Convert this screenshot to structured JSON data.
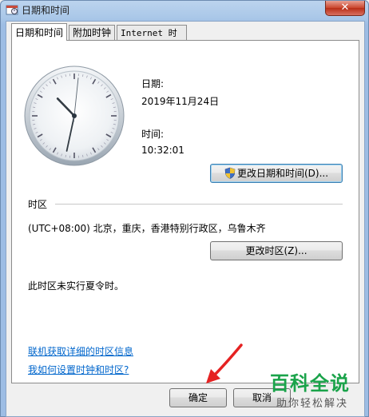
{
  "window": {
    "title": "日期和时间",
    "close_glyph": "✕"
  },
  "tabs": [
    {
      "label": "日期和时间",
      "active": true
    },
    {
      "label": "附加时钟",
      "active": false
    },
    {
      "label": "Internet 时间",
      "active": false
    }
  ],
  "clock": {
    "hours": 10,
    "minutes": 32,
    "seconds": 1
  },
  "date": {
    "label": "日期:",
    "value": "2019年11月24日"
  },
  "time": {
    "label": "时间:",
    "value": "10:32:01"
  },
  "change_datetime_button": {
    "label": "更改日期和时间(D)..."
  },
  "timezone": {
    "section_label": "时区",
    "value": "(UTC+08:00) 北京，重庆，香港特别行政区，乌鲁木齐",
    "change_button": "更改时区(Z)...",
    "dst_note": "此时区未实行夏令时。"
  },
  "links": {
    "timezone_info": "联机获取详细的时区信息",
    "how_to_set": "我如何设置时钟和时区?"
  },
  "footer": {
    "ok_label": "确定",
    "cancel_label": "取消"
  },
  "watermark": {
    "title": "百科全说",
    "subtitle": "助你轻松解决"
  },
  "colors": {
    "link": "#0066cc",
    "watermark_green": "#1aa34a",
    "arrow_red": "#e52222"
  }
}
